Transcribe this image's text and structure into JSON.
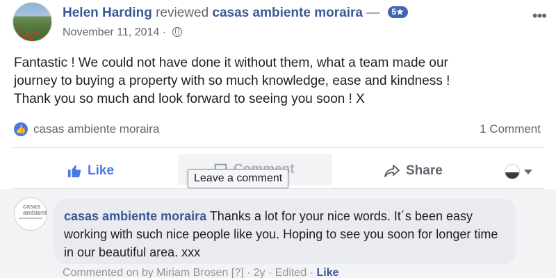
{
  "review": {
    "author": "Helen Harding",
    "verb": "reviewed",
    "page": "casas ambiente moraira",
    "dash": "—",
    "rating_badge": "5★",
    "date": "November 11, 2014",
    "privacy_icon": "globe-icon",
    "text_lines": [
      "Fantastic ! We could not have done it without them, what a team made our",
      "journey to buying a property with so much knowledge, ease and kindness !",
      "Thank you so much and look forward to seeing you soon ! X"
    ]
  },
  "reactions": {
    "icon": "thumbs-up-icon",
    "names": "casas ambiente moraira",
    "comment_count": "1 Comment"
  },
  "actions": {
    "like": "Like",
    "comment": "Comment",
    "share": "Share",
    "tooltip": "Leave a comment"
  },
  "comment": {
    "author": "casas ambiente moraira",
    "text": "Thanks a lot for your nice words. It´s been easy working with such nice people like you. Hoping to see you soon for longer time in our beautiful area. xxx",
    "meta_prefix": "Commented on by Miriam Brosen [?] · 2y · Edited · ",
    "like": "Like"
  },
  "colors": {
    "link_blue": "#385898",
    "like_blue": "#4a78e6",
    "badge_blue": "#4267b2",
    "muted": "#606770"
  }
}
